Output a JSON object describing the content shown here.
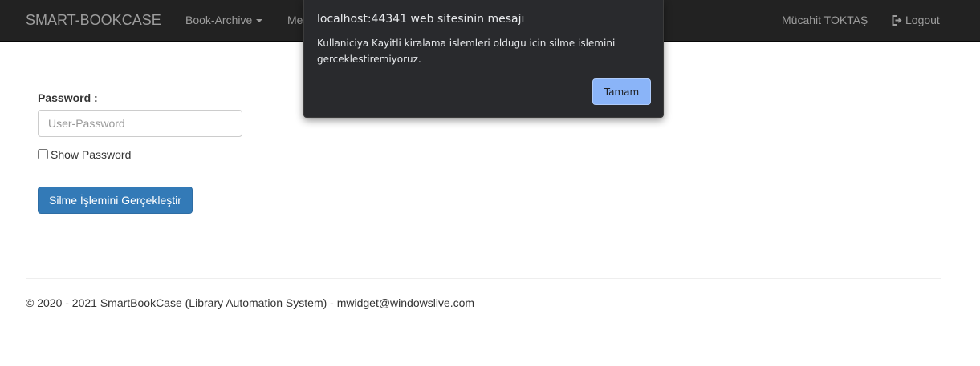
{
  "navbar": {
    "brand": "SMART-BOOKCASE",
    "items": [
      {
        "label": "Book-Archive"
      },
      {
        "label": "Me"
      }
    ],
    "user_name": "Mücahit TOKTAŞ",
    "logout_label": "Logout"
  },
  "form": {
    "password_label": "Password :",
    "password_placeholder": "User-Password",
    "show_password_label": "Show Password",
    "show_password_checked": false,
    "submit_label": "Silme İşlemini Gerçekleştir"
  },
  "footer": {
    "text": "© 2020 - 2021 SmartBookCase (Library Automation System) - mwidget@windowslive.com"
  },
  "dialog": {
    "title": "localhost:44341 web sitesinin mesajı",
    "message": " Kullaniciya Kayitli kiralama islemleri oldugu icin silme islemini gerceklestiremiyoruz.",
    "ok_label": "Tamam"
  },
  "colors": {
    "navbar_bg": "#222222",
    "primary": "#337ab7",
    "dialog_bg": "#292a2d",
    "dialog_button": "#8ab4f8"
  }
}
